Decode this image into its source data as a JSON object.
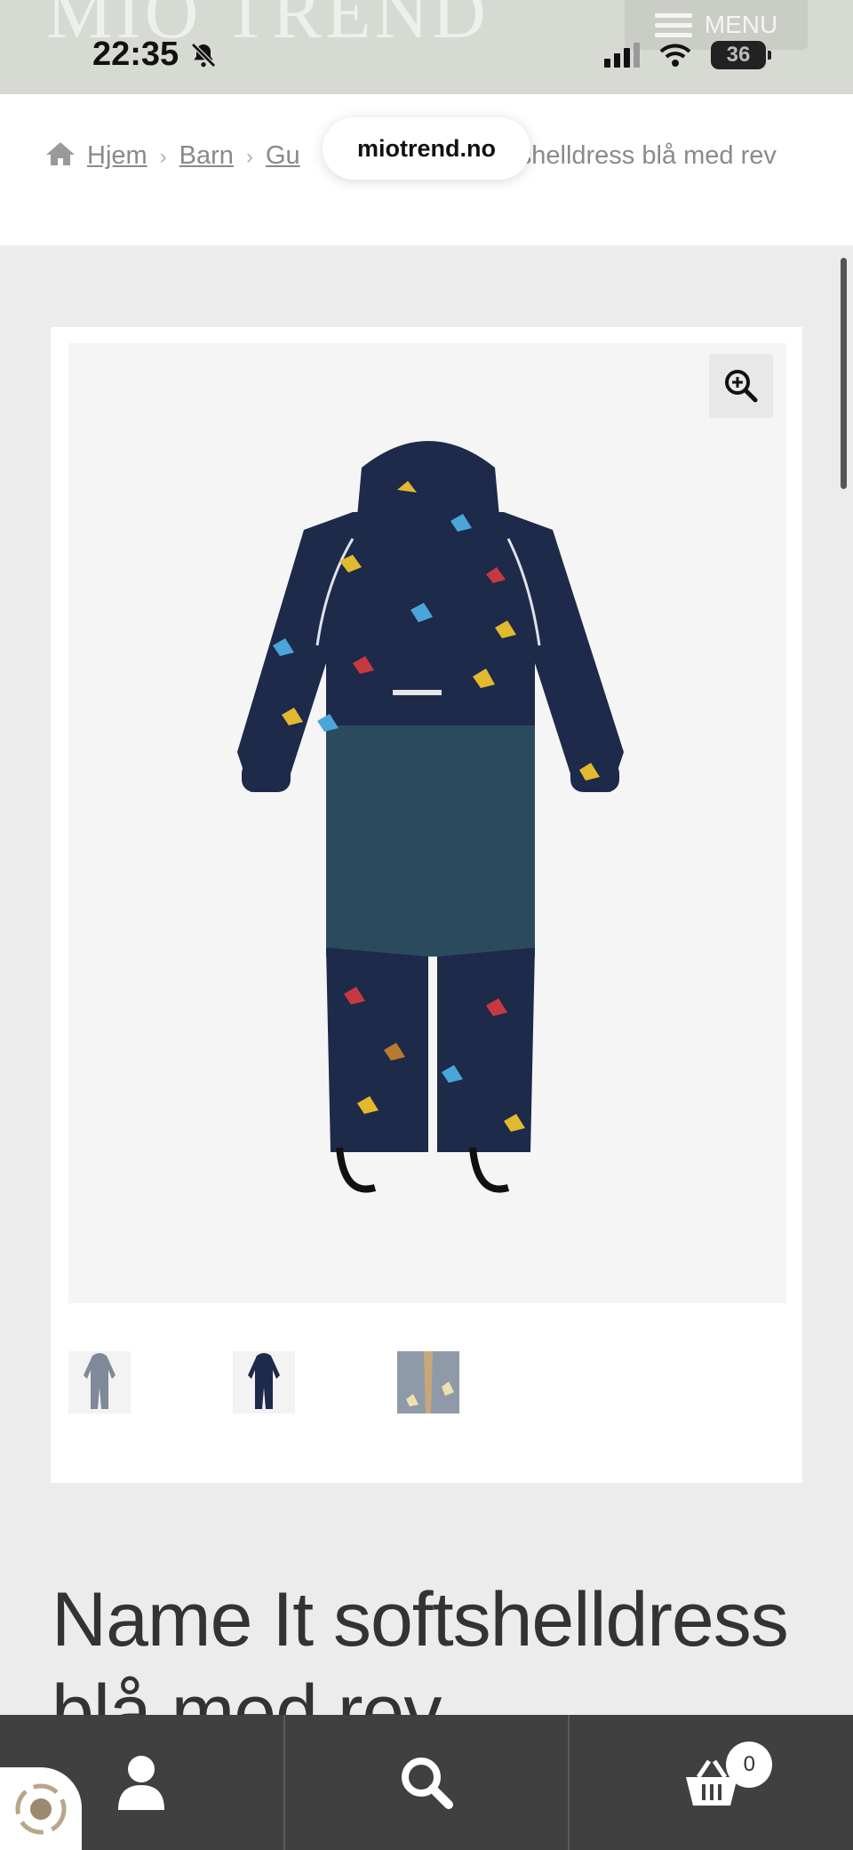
{
  "status_bar": {
    "time": "22:35",
    "battery": "36"
  },
  "header": {
    "logo": "MIO TREND",
    "menu_label": "MENU"
  },
  "browser": {
    "url": "miotrend.no"
  },
  "breadcrumb": {
    "items": [
      "Hjem",
      "Barn",
      "Gu"
    ],
    "current": "ftshelldress blå med rev"
  },
  "product": {
    "title": "Name It softshelldress blå med rev"
  },
  "cart": {
    "count": "0"
  },
  "icons": [
    "home-icon",
    "bell-slash-icon",
    "signal-icon",
    "wifi-icon",
    "zoom-in-icon",
    "user-icon",
    "search-icon",
    "basket-icon",
    "widget-icon"
  ],
  "colors": {
    "header_bg": "#d6dad3",
    "nav_bg": "#404040",
    "suit_navy": "#1d2a4a",
    "suit_panel": "#2c4a5e"
  }
}
